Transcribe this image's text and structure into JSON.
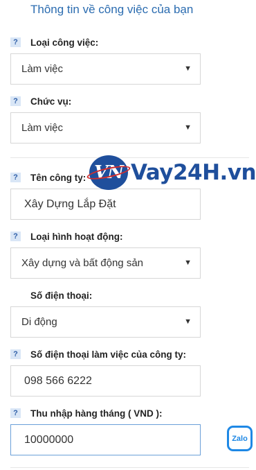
{
  "header": {
    "title": "Thông tin về công việc của bạn"
  },
  "help_glyph": "?",
  "caret_glyph": "▼",
  "fields": {
    "job_type": {
      "label": "Loại công việc:",
      "value": "Làm việc"
    },
    "position": {
      "label": "Chức vụ:",
      "value": "Làm việc"
    },
    "company_name": {
      "label": "Tên công ty:",
      "value": "Xây Dựng Lắp Đặt"
    },
    "business_type": {
      "label": "Loại hình hoạt động:",
      "value": "Xây dựng và bất động sản"
    },
    "phone": {
      "label": "Số điện thoại:",
      "value": "Di động"
    },
    "company_phone": {
      "label": "Số điện thoại làm việc của công ty:",
      "value": "098 566 6222"
    },
    "monthly_income": {
      "label": "Thu nhập hàng tháng ( VND ):",
      "value": "10000000"
    }
  },
  "watermark": {
    "logo_text": "VN",
    "text": "Vay24H.vn"
  },
  "zalo": {
    "label": "Zalo"
  },
  "colors": {
    "title": "#2b6cb0",
    "brand": "#1f4f9c",
    "zalo": "#1e88e5"
  }
}
